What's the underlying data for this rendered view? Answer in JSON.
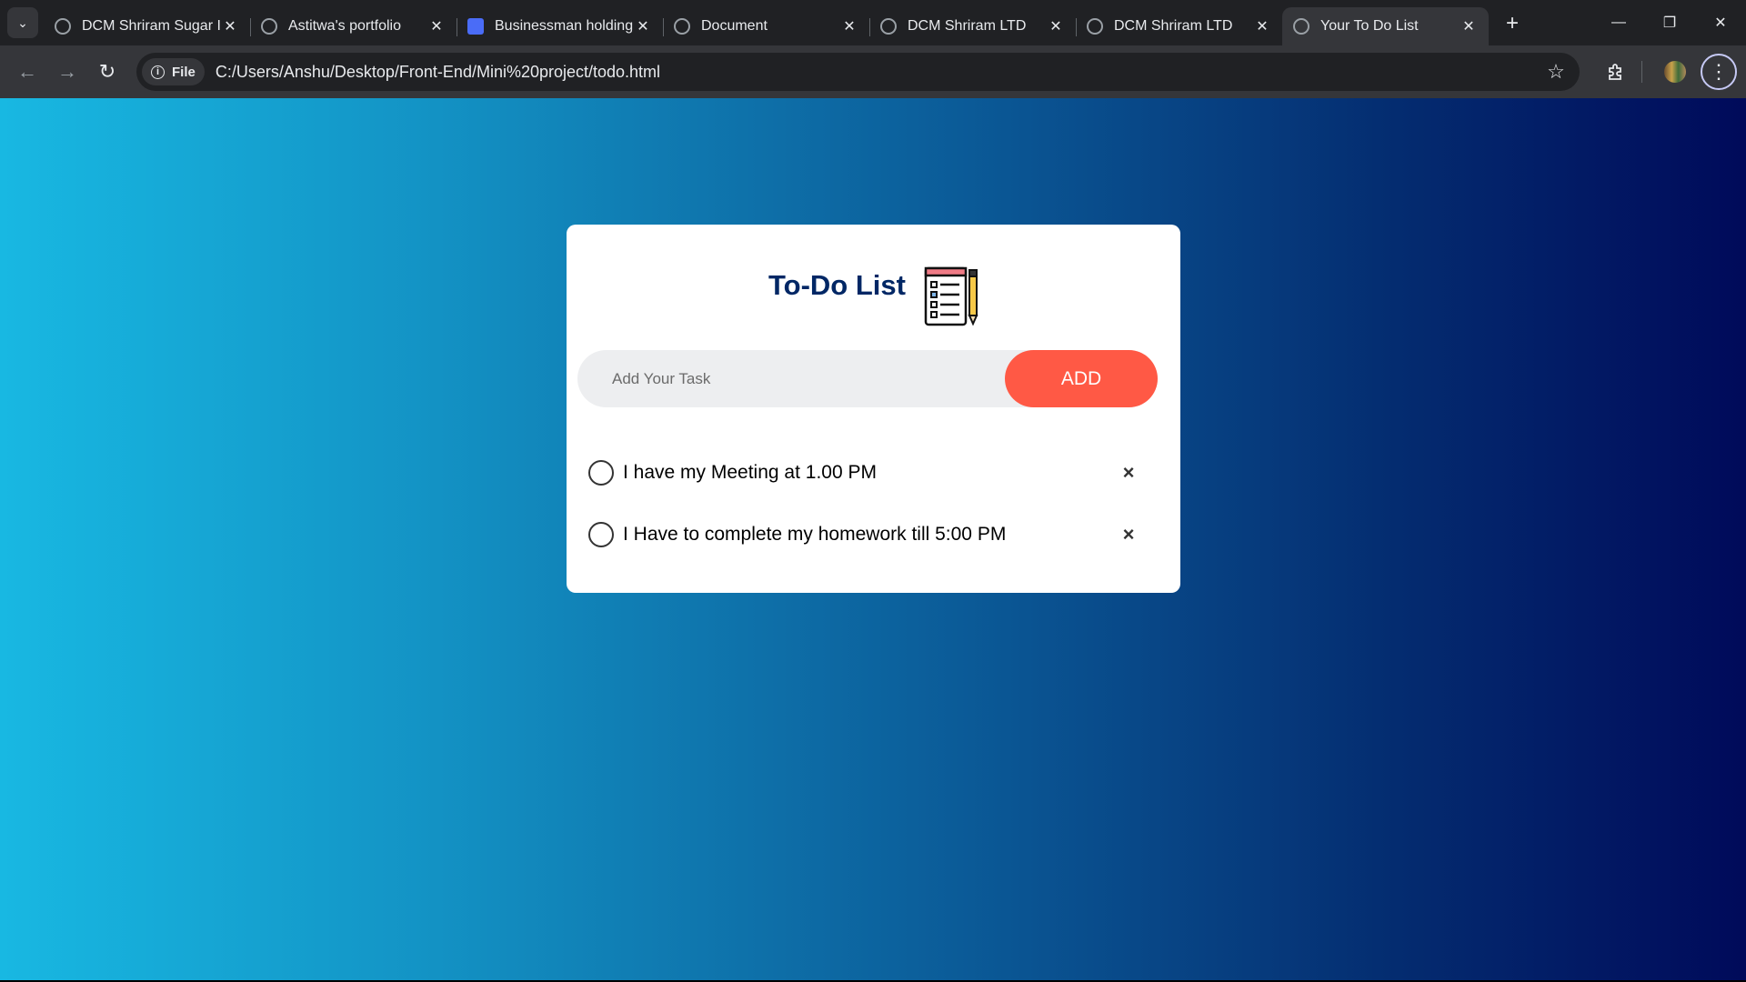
{
  "browser": {
    "tabs": [
      {
        "title": "DCM Shriram Sugar I",
        "favicon": "openai-icon",
        "active": false
      },
      {
        "title": "Astitwa's portfolio",
        "favicon": "globe-icon",
        "active": false
      },
      {
        "title": "Businessman holding",
        "favicon": "doc-icon",
        "active": false
      },
      {
        "title": "Document",
        "favicon": "globe-icon",
        "active": false
      },
      {
        "title": "DCM Shriram LTD",
        "favicon": "globe-icon",
        "active": false
      },
      {
        "title": "DCM Shriram LTD",
        "favicon": "globe-icon",
        "active": false
      },
      {
        "title": "Your To Do List",
        "favicon": "globe-icon",
        "active": true
      }
    ],
    "new_tab_symbol": "+",
    "site_chip_label": "File",
    "url": "C:/Users/Anshu/Desktop/Front-End/Mini%20project/todo.html"
  },
  "app": {
    "title": "To-Do List",
    "input_placeholder": "Add Your Task",
    "add_label": "ADD",
    "tasks": [
      {
        "text": "I have my Meeting at 1.00 PM",
        "checked": false
      },
      {
        "text": "I Have to complete my homework till 5:00 PM",
        "checked": false
      }
    ],
    "delete_symbol": "×"
  },
  "colors": {
    "accent": "#ff5945",
    "title": "#002765",
    "background_start": "#18b8e2",
    "background_end": "#000a5a"
  }
}
